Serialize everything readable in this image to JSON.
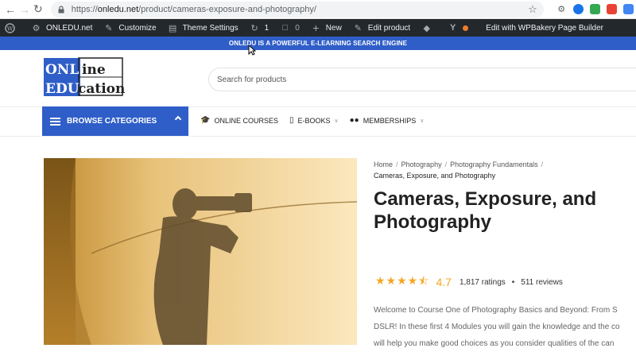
{
  "browser": {
    "url_prefix": "https://",
    "url_host": "onledu.net",
    "url_path": "/product/cameras-exposure-and-photography/"
  },
  "adminbar": {
    "site": "ONLEDU.net",
    "customize": "Customize",
    "theme_settings": "Theme Settings",
    "updates_count": "1",
    "comments_count": "0",
    "new": "New",
    "edit_product": "Edit product",
    "wpbakery": "Edit with WPBakery Page Builder"
  },
  "announcement": "ONLEDU IS A POWERFUL E-LEARNING SEARCH ENGINE",
  "logo": {
    "line1_a": "ONL",
    "line1_b": "ine",
    "line2_a": "EDU",
    "line2_b": "cation"
  },
  "search": {
    "placeholder": "Search for products"
  },
  "browse": {
    "label": "BROWSE CATEGORIES"
  },
  "menu": [
    {
      "label": "ONLINE COURSES",
      "icon": "graduation-cap-icon"
    },
    {
      "label": "E-BOOKS",
      "icon": "tablet-icon"
    },
    {
      "label": "MEMBERSHIPS",
      "icon": "users-icon"
    }
  ],
  "breadcrumb": {
    "home": "Home",
    "cat1": "Photography",
    "cat2": "Photography Fundamentals",
    "current": "Cameras, Exposure, and Photography"
  },
  "product": {
    "title": "Cameras, Exposure, and Photography",
    "rating": 4.7,
    "rating_label": "4.7",
    "ratings_count": "1,817 ratings",
    "reviews_count": "511 reviews",
    "desc_line1": "Welcome to Course One of Photography Basics and Beyond: From S",
    "desc_line2": "DSLR! In these first 4 Modules you will gain the knowledge and the co",
    "desc_line3": "will help you make good choices as you consider qualities of the can"
  },
  "colors": {
    "brand_blue": "#2f5ec8",
    "star": "#f5a623",
    "adminbar": "#23282d"
  }
}
